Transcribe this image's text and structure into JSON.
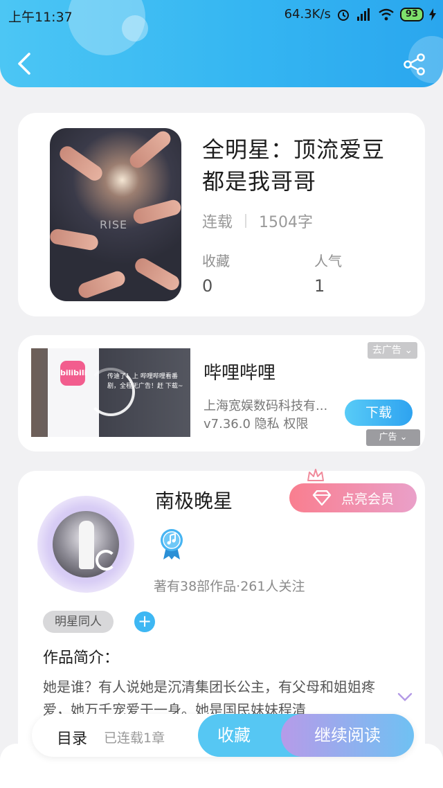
{
  "status_bar": {
    "time": "上午11:37",
    "net_speed": "64.3K/s",
    "battery": "93"
  },
  "book": {
    "title": "全明星：顶流爱豆都是我哥哥",
    "status": "连载",
    "word_count": "1504字",
    "collect_label": "收藏",
    "collect_value": "0",
    "popularity_label": "人气",
    "popularity_value": "1",
    "cover_text": "RISE"
  },
  "ad": {
    "remove_label": "去广告",
    "app_name": "哔哩哔哩",
    "company": "上海宽娱数码科技有...",
    "version_info": "v7.36.0  隐私  权限",
    "download_label": "下载",
    "badge_label": "广告",
    "image_text": "传迪了！上 哔哩哔哩看番剧，全程无广告！赶 下载~",
    "logo_text": "bilibili"
  },
  "author": {
    "name": "南极晚星",
    "vip_label": "点亮会员",
    "stats": "著有38部作品·261人关注",
    "tag": "明星同人",
    "tag_add": "+",
    "intro_label": "作品简介：",
    "intro_text": "她是谁？有人说她是沉清集团长公主，有父母和姐姐疼爱，她万千宠爱于一身。她是国民妹妹程清"
  },
  "bottom_bar": {
    "toc_label": "目录",
    "toc_count": "已连载1章",
    "favorite_label": "收藏",
    "continue_label": "继续阅读"
  },
  "colors": {
    "header_blue": "#35b6f2",
    "accent_blue": "#3eb7f3",
    "vip_pink": "#f97e8f",
    "read_purple": "#b69be9"
  },
  "icons": [
    "back-arrow-icon",
    "share-icon",
    "alarm-icon",
    "signal-icon",
    "wifi-icon",
    "crown-icon",
    "diamond-icon",
    "music-badge-icon",
    "chevron-down-icon"
  ]
}
